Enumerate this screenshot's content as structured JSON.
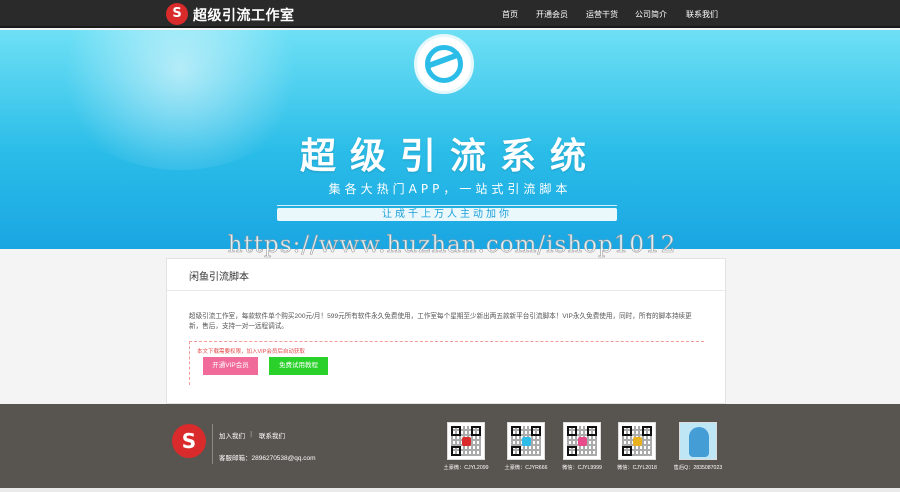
{
  "header": {
    "logo_text": "超级引流工作室",
    "nav": [
      "首页",
      "开通会员",
      "运营干货",
      "公司简介",
      "联系我们"
    ]
  },
  "hero": {
    "title": "超级引流系统",
    "subtitle": "集各大热门APP，一站式引流脚本",
    "button": "让成千上万人主动加你"
  },
  "watermark": "https://www.huzhan.com/ishop1012",
  "card": {
    "title": "闲鱼引流脚本",
    "description": "超级引流工作室，每款软件单个购买200元/月！599元所有软件永久免费使用，工作室每个星期至少新出两五款新平台引流脚本！VIP永久免费使用，同时，所有的脚本持续更新，售后，支持一对一远程调试。",
    "download_tip": "本文下载需要权限，加入VIP会员后自动获取",
    "buttons": [
      "开通VIP会员",
      "免费试用教程"
    ]
  },
  "footer": {
    "links": [
      "加入我们",
      "联系我们"
    ],
    "divider": "|",
    "email": "客服邮箱：2896270538@qq.com",
    "qrcodes": [
      {
        "label": "土豪微：CJYL2099"
      },
      {
        "label": "土豪微：CJYR666"
      },
      {
        "label": "微信：CJYL9999"
      },
      {
        "label": "微信：CJYL2018"
      },
      {
        "label": "售后Q：2835087023"
      }
    ]
  },
  "colors": {
    "topbar": "#2a2a2a",
    "hero_cyan": "#2bbde8",
    "brand_red": "#d92b2b",
    "pink_button": "#f06a9a",
    "green_button": "#2ad12a",
    "footer": "#58544f"
  }
}
